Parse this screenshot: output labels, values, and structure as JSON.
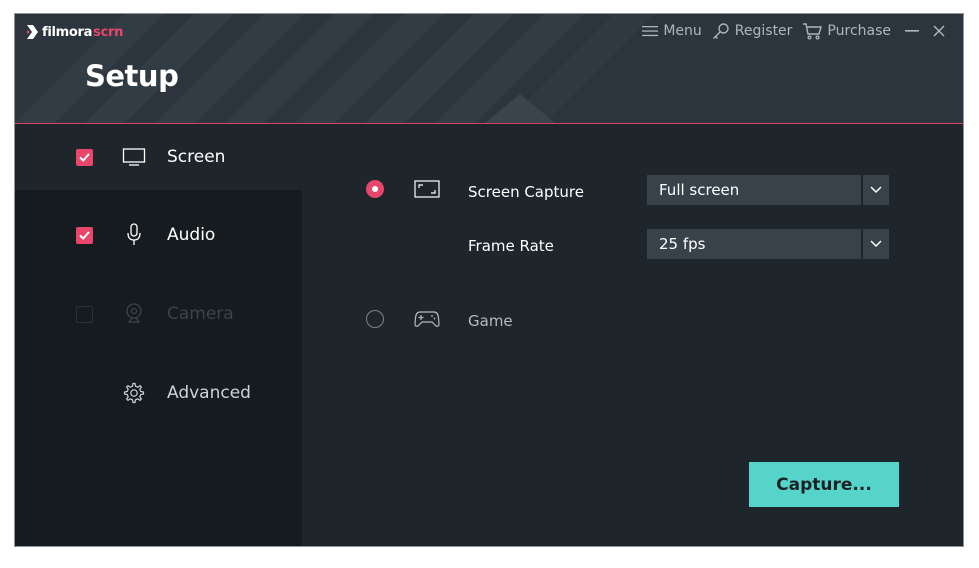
{
  "app": {
    "logo_main": "filmora",
    "logo_accent": "scrn"
  },
  "header": {
    "title": "Setup"
  },
  "topbar": {
    "menu": "Menu",
    "register": "Register",
    "purchase": "Purchase"
  },
  "sidebar": {
    "items": [
      {
        "label": "Screen",
        "checked": true,
        "icon": "monitor-icon"
      },
      {
        "label": "Audio",
        "checked": true,
        "icon": "microphone-icon"
      },
      {
        "label": "Camera",
        "checked": false,
        "icon": "webcam-icon"
      },
      {
        "label": "Advanced",
        "icon": "gear-icon"
      }
    ]
  },
  "main": {
    "screen_capture": {
      "label": "Screen Capture",
      "value": "Full screen",
      "selected": true
    },
    "frame_rate": {
      "label": "Frame Rate",
      "value": "25 fps"
    },
    "game": {
      "label": "Game",
      "selected": false
    },
    "capture_button": "Capture..."
  },
  "colors": {
    "accent": "#e8466a",
    "capture": "#57d4c9",
    "header_bg": "#2c353d",
    "sidebar_bg": "#161b1f",
    "main_bg": "#1e252b"
  }
}
